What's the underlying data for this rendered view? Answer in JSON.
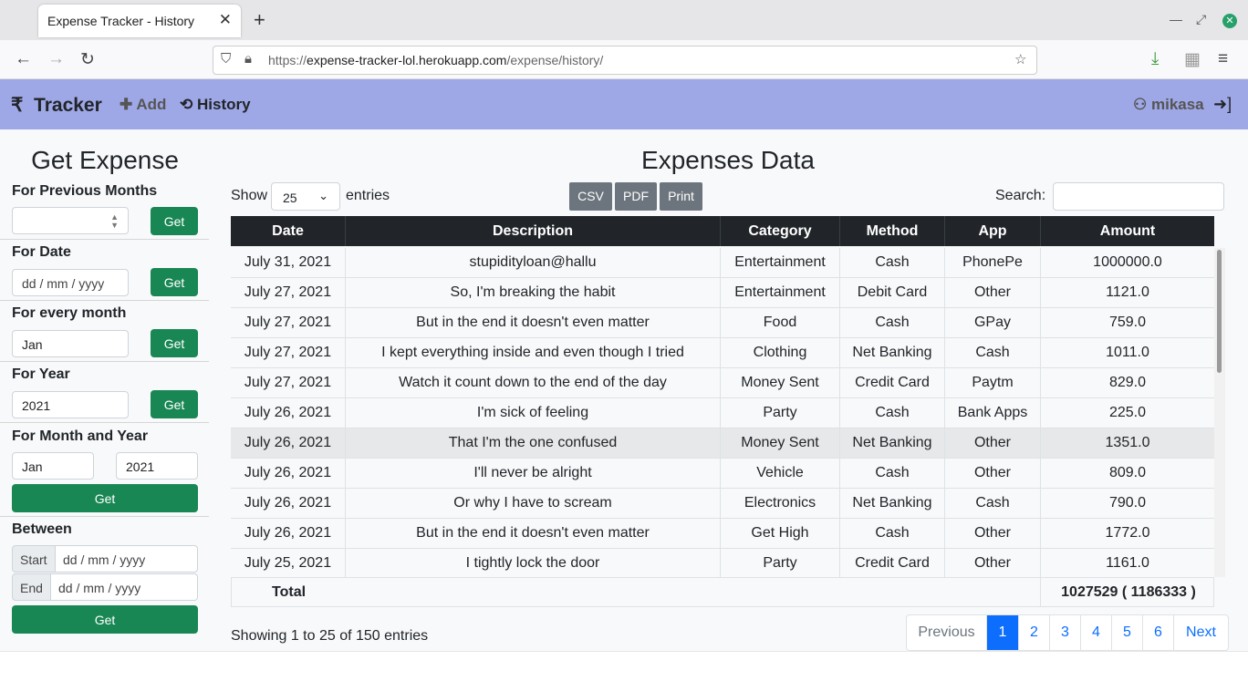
{
  "browser": {
    "tab_title": "Expense Tracker - History",
    "url_prefix": "https://",
    "url_host": "expense-tracker-lol.herokuapp.com",
    "url_path": "/expense/history/"
  },
  "nav": {
    "brand": "Tracker",
    "add": "Add",
    "history": "History",
    "user": "mikasa"
  },
  "sidebar": {
    "title": "Get Expense",
    "prev_months_label": "For Previous Months",
    "date_label": "For Date",
    "date_placeholder": "dd / mm / yyyy",
    "every_month_label": "For every month",
    "every_month_value": "Jan",
    "year_label": "For Year",
    "year_value": "2021",
    "month_year_label": "For Month and Year",
    "my_month_value": "Jan",
    "my_year_value": "2021",
    "between_label": "Between",
    "start_label": "Start",
    "end_label": "End",
    "get": "Get"
  },
  "main": {
    "title": "Expenses Data",
    "show_label": "Show",
    "entries_label": "entries",
    "page_size": "25",
    "buttons": [
      "CSV",
      "PDF",
      "Print"
    ],
    "search_label": "Search:",
    "columns": [
      "Date",
      "Description",
      "Category",
      "Method",
      "App",
      "Amount"
    ],
    "rows": [
      [
        "July 31, 2021",
        "stupidityloan@hallu",
        "Entertainment",
        "Cash",
        "PhonePe",
        "1000000.0"
      ],
      [
        "July 27, 2021",
        "So, I'm breaking the habit",
        "Entertainment",
        "Debit Card",
        "Other",
        "1121.0"
      ],
      [
        "July 27, 2021",
        "But in the end it doesn't even matter",
        "Food",
        "Cash",
        "GPay",
        "759.0"
      ],
      [
        "July 27, 2021",
        "I kept everything inside and even though I tried",
        "Clothing",
        "Net Banking",
        "Cash",
        "1011.0"
      ],
      [
        "July 27, 2021",
        "Watch it count down to the end of the day",
        "Money Sent",
        "Credit Card",
        "Paytm",
        "829.0"
      ],
      [
        "July 26, 2021",
        "I'm sick of feeling",
        "Party",
        "Cash",
        "Bank Apps",
        "225.0"
      ],
      [
        "July 26, 2021",
        "That I'm the one confused",
        "Money Sent",
        "Net Banking",
        "Other",
        "1351.0"
      ],
      [
        "July 26, 2021",
        "I'll never be alright",
        "Vehicle",
        "Cash",
        "Other",
        "809.0"
      ],
      [
        "July 26, 2021",
        "Or why I have to scream",
        "Electronics",
        "Net Banking",
        "Cash",
        "790.0"
      ],
      [
        "July 26, 2021",
        "But in the end it doesn't even matter",
        "Get High",
        "Cash",
        "Other",
        "1772.0"
      ],
      [
        "July 25, 2021",
        "I tightly lock the door",
        "Party",
        "Credit Card",
        "Other",
        "1161.0"
      ]
    ],
    "total_label": "Total",
    "total_value": "1027529 ( 1186333 )",
    "info": "Showing 1 to 25 of 150 entries",
    "pagination": [
      "Previous",
      "1",
      "2",
      "3",
      "4",
      "5",
      "6",
      "Next"
    ]
  }
}
